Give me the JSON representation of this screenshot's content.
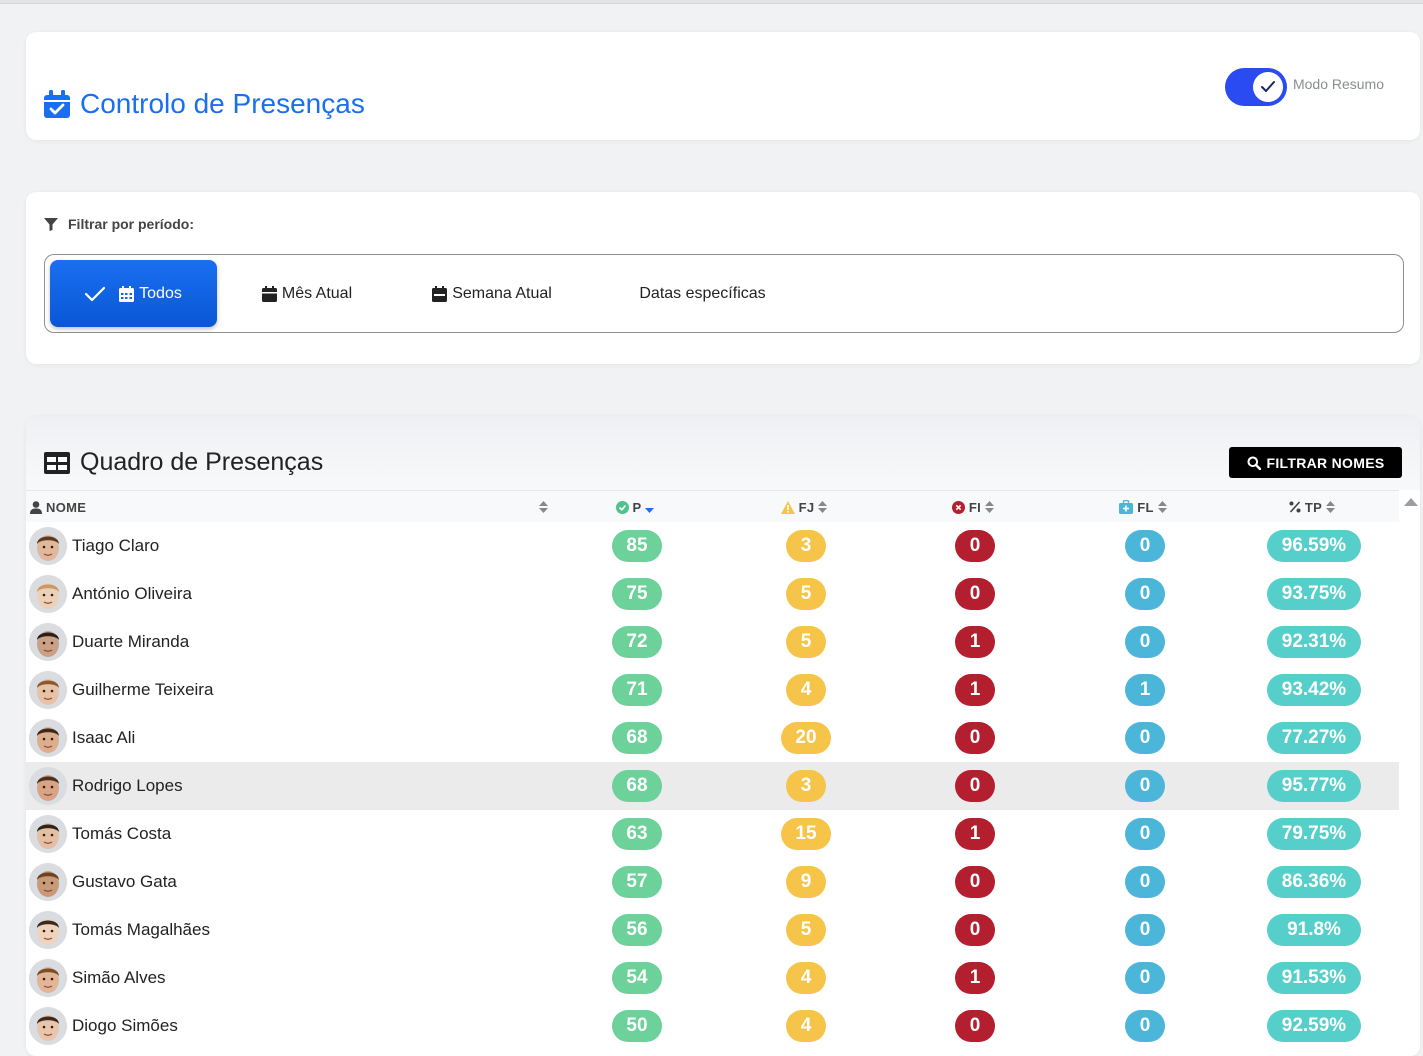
{
  "header": {
    "title": "Controlo de Presenças",
    "toggle_label": "Modo Resumo",
    "toggle_on": true
  },
  "filter": {
    "title": "Filtrar por período:",
    "options": [
      {
        "label": "Todos",
        "icon": "calendar-icon",
        "active": true
      },
      {
        "label": "Mês Atual",
        "icon": "calendar-icon",
        "active": false
      },
      {
        "label": "Semana Atual",
        "icon": "calendar-week-icon",
        "active": false
      },
      {
        "label": "Datas específicas",
        "icon": "",
        "active": false
      }
    ]
  },
  "table": {
    "title": "Quadro de Presenças",
    "filter_button": "FILTRAR NOMES",
    "columns": {
      "name": "NOME",
      "p": "P",
      "fj": "FJ",
      "fi": "FI",
      "fl": "FL",
      "tp": "TP"
    },
    "rows": [
      {
        "name": "Tiago Claro",
        "p": "85",
        "fj": "3",
        "fi": "0",
        "fl": "0",
        "tp": "96.59%"
      },
      {
        "name": "António Oliveira",
        "p": "75",
        "fj": "5",
        "fi": "0",
        "fl": "0",
        "tp": "93.75%"
      },
      {
        "name": "Duarte Miranda",
        "p": "72",
        "fj": "5",
        "fi": "1",
        "fl": "0",
        "tp": "92.31%"
      },
      {
        "name": "Guilherme Teixeira",
        "p": "71",
        "fj": "4",
        "fi": "1",
        "fl": "1",
        "tp": "93.42%"
      },
      {
        "name": "Isaac Ali",
        "p": "68",
        "fj": "20",
        "fi": "0",
        "fl": "0",
        "tp": "77.27%"
      },
      {
        "name": "Rodrigo Lopes",
        "p": "68",
        "fj": "3",
        "fi": "0",
        "fl": "0",
        "tp": "95.77%"
      },
      {
        "name": "Tomás Costa",
        "p": "63",
        "fj": "15",
        "fi": "1",
        "fl": "0",
        "tp": "79.75%"
      },
      {
        "name": "Gustavo Gata",
        "p": "57",
        "fj": "9",
        "fi": "0",
        "fl": "0",
        "tp": "86.36%"
      },
      {
        "name": "Tomás Magalhães",
        "p": "56",
        "fj": "5",
        "fi": "0",
        "fl": "0",
        "tp": "91.8%"
      },
      {
        "name": "Simão Alves",
        "p": "54",
        "fj": "4",
        "fi": "1",
        "fl": "0",
        "tp": "91.53%"
      },
      {
        "name": "Diogo Simões",
        "p": "50",
        "fj": "4",
        "fi": "0",
        "fl": "0",
        "tp": "92.59%"
      }
    ]
  },
  "colors": {
    "accent": "#1a6ff0",
    "toggle": "#2a4bf2",
    "p": "#6dd19a",
    "fj": "#f7c44a",
    "fi": "#b31f2e",
    "fl": "#4bb6d9",
    "tp": "#56cfca"
  }
}
